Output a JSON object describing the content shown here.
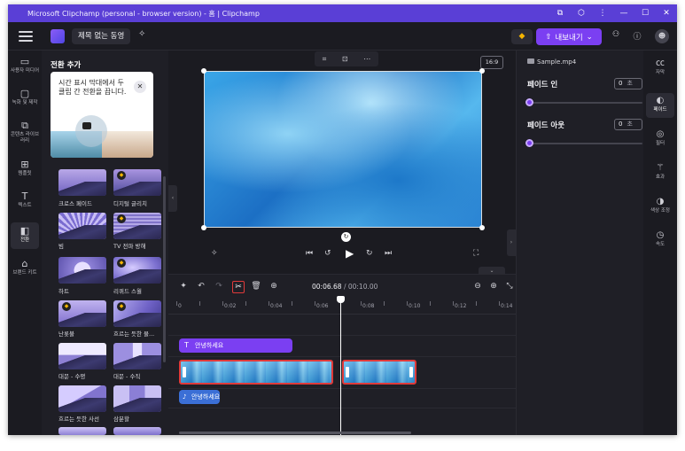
{
  "window": {
    "title": "Microsoft Clipchamp (personal - browser version) - 홈 | Clipchamp",
    "controls": [
      "restore-icon",
      "extension-icon",
      "more-icon",
      "minimize-icon",
      "maximize-icon",
      "close-icon"
    ]
  },
  "header": {
    "project_title": "제목 없는 동영",
    "export_label": "내보내기",
    "accent": "#7b3ff2"
  },
  "left_rail": [
    {
      "label": "사용자 미디어",
      "icon": "folder-icon"
    },
    {
      "label": "녹화 및 제작",
      "icon": "record-icon"
    },
    {
      "label": "콘텐츠 라이브러리",
      "icon": "library-icon"
    },
    {
      "label": "템플릿",
      "icon": "templates-icon"
    },
    {
      "label": "텍스트",
      "icon": "text-icon"
    },
    {
      "label": "전환",
      "icon": "transition-icon",
      "active": true
    },
    {
      "label": "브랜드 키트",
      "icon": "brand-kit-icon"
    }
  ],
  "panel": {
    "title": "전환 추가",
    "tip_text": "시간 표시 막대에서 두 클립 간 전환을 끕니다.",
    "transitions": [
      {
        "label": "크로스 페이드",
        "premium": false
      },
      {
        "label": "디지털 글리치",
        "premium": true
      },
      {
        "label": "빔",
        "premium": false
      },
      {
        "label": "TV 전파 방해",
        "premium": true
      },
      {
        "label": "하트",
        "premium": false
      },
      {
        "label": "리퀴드 스월",
        "premium": true
      },
      {
        "label": "난롯불",
        "premium": true
      },
      {
        "label": "흐르는 듯한 물...",
        "premium": true
      },
      {
        "label": "대문 - 수평",
        "premium": false
      },
      {
        "label": "대문 - 수직",
        "premium": false
      },
      {
        "label": "흐르는 듯한 사선",
        "premium": false
      },
      {
        "label": "삼분할",
        "premium": false
      }
    ]
  },
  "preview": {
    "aspect_ratio": "16:9"
  },
  "timeline": {
    "current_time": "00:06.68",
    "total_time": "/ 00:10.00",
    "ticks": [
      "0",
      "0:02",
      "0:04",
      "0:06",
      "0:08",
      "0:10",
      "0:12",
      "0:14"
    ],
    "text_clip": "안녕하세요",
    "audio_clip": "안녕하세요"
  },
  "right_panel": {
    "file_name": "Sample.mp4",
    "fade_in_label": "페이드 인",
    "fade_in_value": "0",
    "fade_out_label": "페이드 아웃",
    "fade_out_value": "0",
    "unit": "초"
  },
  "right_rail": [
    {
      "label": "자막",
      "icon": "captions-icon"
    },
    {
      "label": "페이드",
      "icon": "fade-icon",
      "active": true
    },
    {
      "label": "필터",
      "icon": "filters-icon"
    },
    {
      "label": "효과",
      "icon": "effects-icon"
    },
    {
      "label": "색상 조정",
      "icon": "color-adjust-icon"
    },
    {
      "label": "속도",
      "icon": "speed-icon"
    }
  ]
}
